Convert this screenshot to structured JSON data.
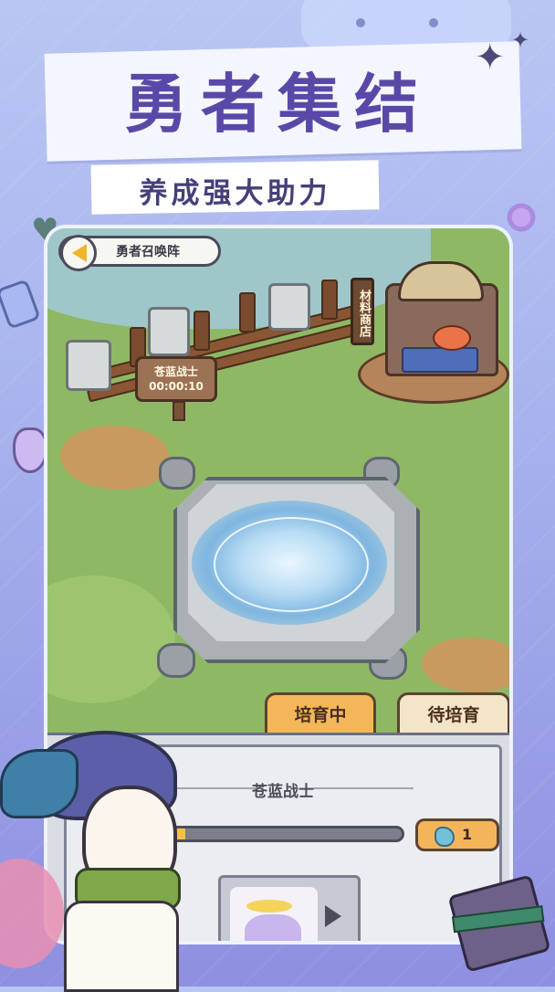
{
  "title": "勇者集结",
  "subtitle": "养成强大助力",
  "game": {
    "header_title": "勇者召唤阵",
    "shop_sign": "材料商店",
    "timer": {
      "name": "苍蓝战士",
      "time": "00:00:10"
    },
    "tabs": [
      {
        "label": "培育中",
        "active": true
      },
      {
        "label": "待培育",
        "active": false
      }
    ],
    "panel": {
      "hero_name": "苍蓝战士",
      "progress": 0.22,
      "item_count": "1"
    }
  },
  "colors": {
    "accent": "#5a48a8",
    "tab_active": "#f3b75a",
    "tab_idle": "#f4e4c8",
    "progress": "#f4c04a"
  },
  "icons": [
    "back-arrow-icon",
    "gem-icon",
    "play-icon",
    "sparkle-icon",
    "heart-icon"
  ]
}
